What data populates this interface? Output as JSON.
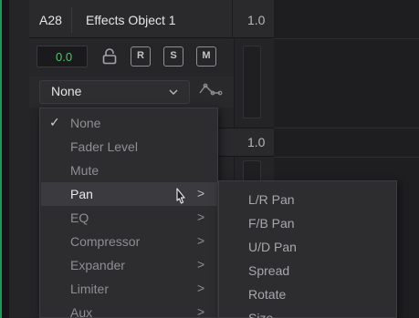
{
  "track": {
    "id": "A28",
    "name": "Effects Object 1",
    "gain_readout": "1.0",
    "fader_value": "0.0",
    "buttons": {
      "record": "R",
      "solo": "S",
      "mute": "M"
    },
    "automation_mode": "None",
    "second_row_gain": "1.0"
  },
  "menu": {
    "items": [
      {
        "label": "None",
        "checked": "✓",
        "arrow": ""
      },
      {
        "label": "Fader Level",
        "checked": "",
        "arrow": ""
      },
      {
        "label": "Mute",
        "checked": "",
        "arrow": ""
      },
      {
        "label": "Pan",
        "checked": "",
        "arrow": ">"
      },
      {
        "label": "EQ",
        "checked": "",
        "arrow": ">"
      },
      {
        "label": "Compressor",
        "checked": "",
        "arrow": ">"
      },
      {
        "label": "Expander",
        "checked": "",
        "arrow": ">"
      },
      {
        "label": "Limiter",
        "checked": "",
        "arrow": ">"
      },
      {
        "label": "Aux",
        "checked": "",
        "arrow": ">"
      }
    ],
    "highlighted": "Pan"
  },
  "submenu": {
    "items": [
      "L/R Pan",
      "F/B Pan",
      "U/D Pan",
      "Spread",
      "Rotate",
      "Size"
    ]
  },
  "colors": {
    "accent_green": "#55c26d",
    "track_edge": "#1f9a5a",
    "menu_bg": "#2d2d30",
    "highlight_bg": "#3b3b3f"
  },
  "icons": {
    "lock": "lock-icon",
    "chevron": "chevron-down-icon",
    "curve": "automation-curve-icon",
    "cursor": "mouse-pointer-icon",
    "check": "checkmark-icon",
    "arrow": "chevron-right-icon"
  }
}
